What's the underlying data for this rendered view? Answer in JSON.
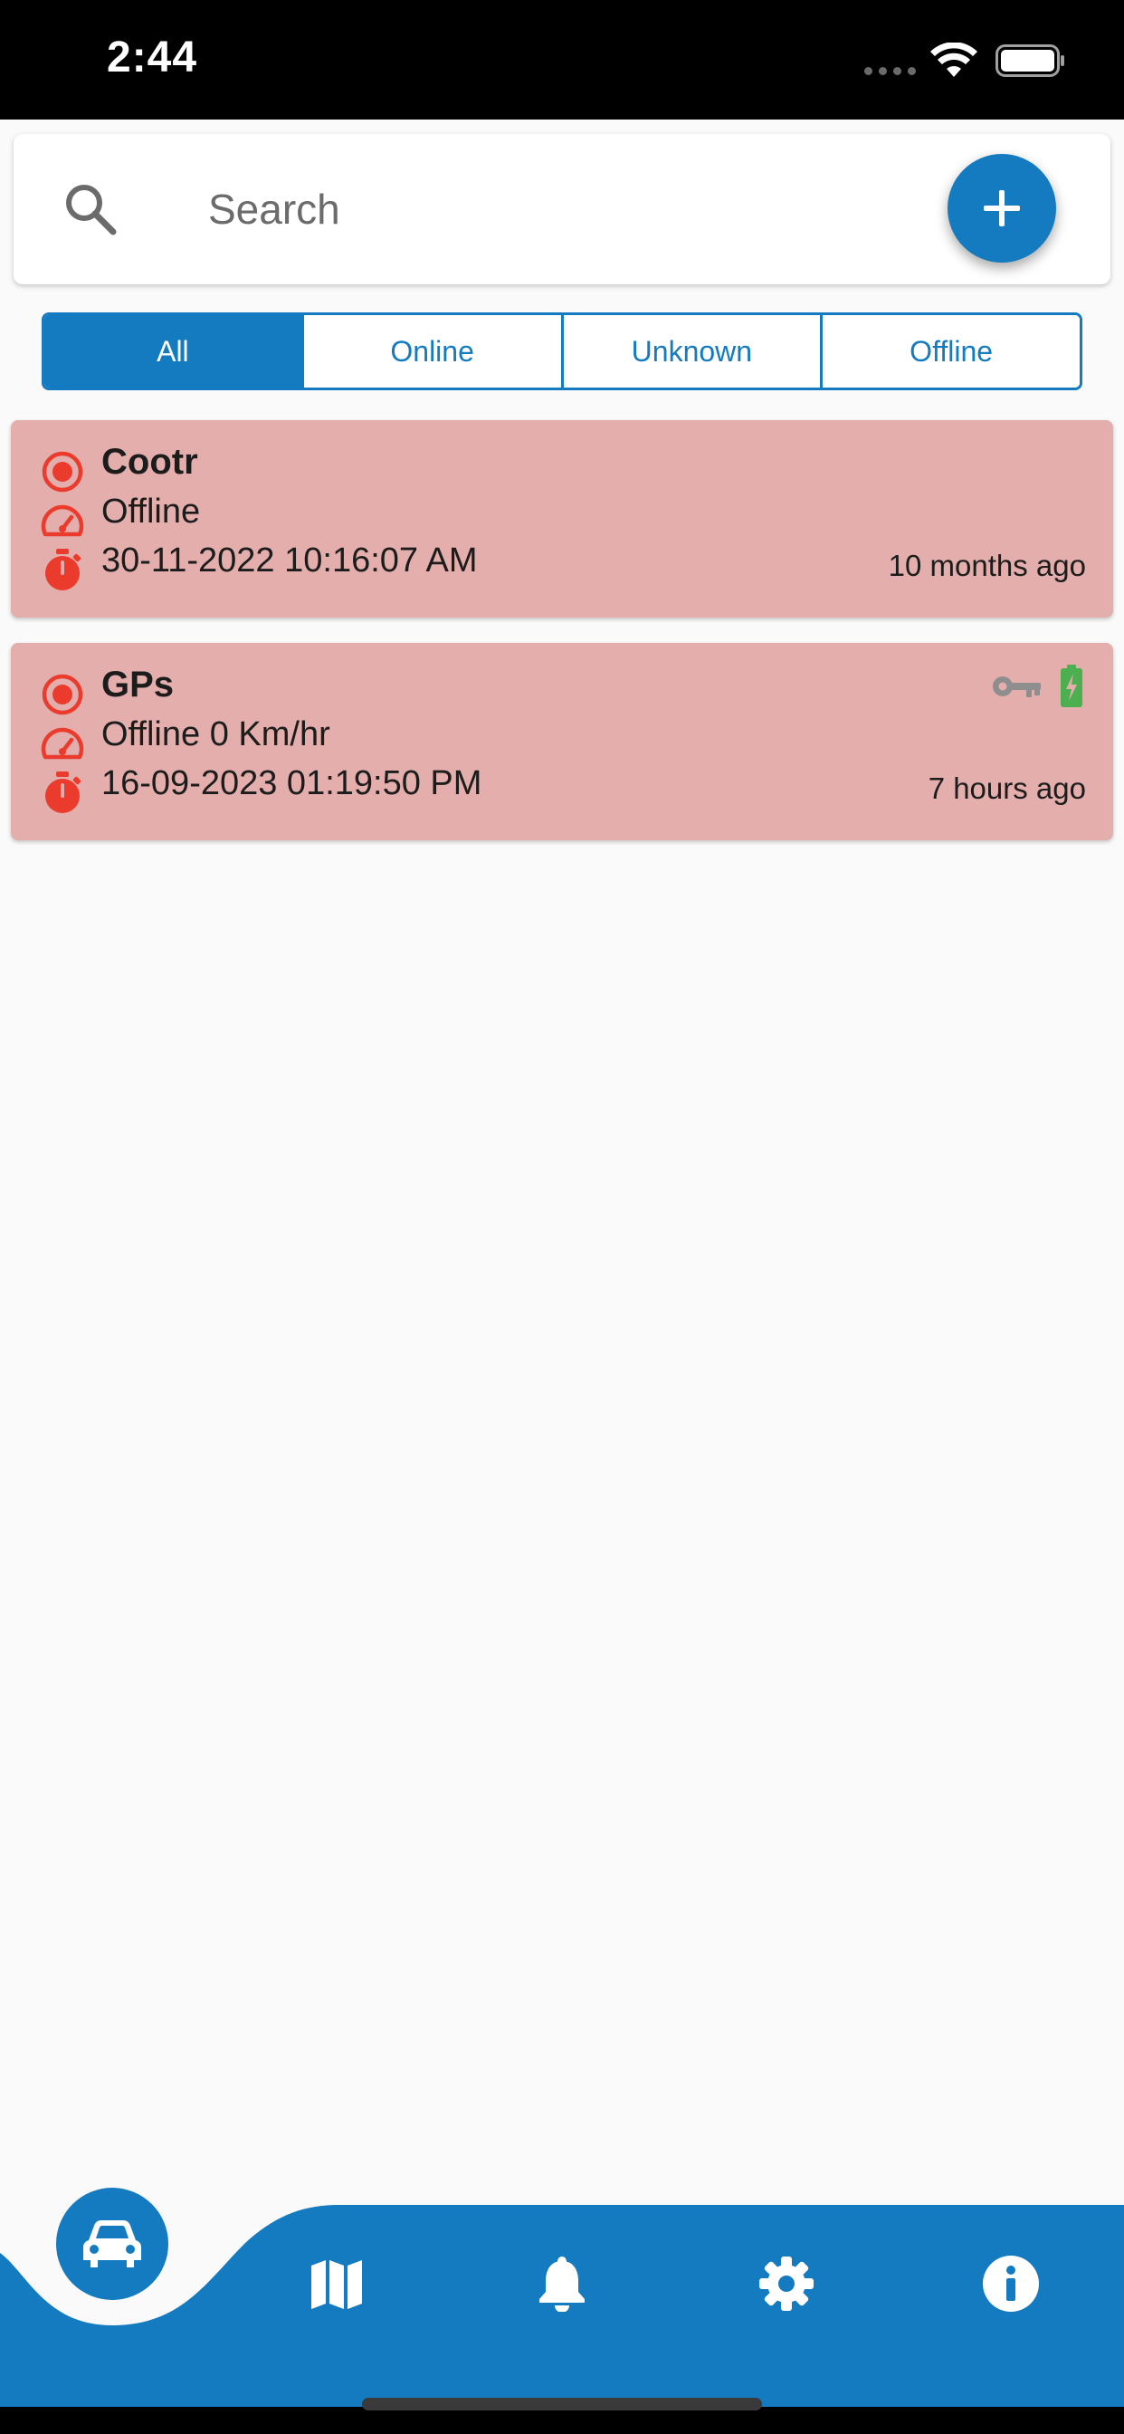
{
  "status_bar": {
    "time": "2:44"
  },
  "search": {
    "placeholder": "Search",
    "value": ""
  },
  "filters": [
    {
      "label": "All",
      "active": true
    },
    {
      "label": "Online",
      "active": false
    },
    {
      "label": "Unknown",
      "active": false
    },
    {
      "label": "Offline",
      "active": false
    }
  ],
  "devices": [
    {
      "name": "Cootr",
      "status": "Offline",
      "timestamp": "30-11-2022 10:16:07 AM",
      "ago": "10 months ago"
    },
    {
      "name": "GPs",
      "status": "Offline 0 Km/hr",
      "timestamp": "16-09-2023 01:19:50 PM",
      "ago": "7 hours ago"
    }
  ],
  "bottom_nav": {
    "items": [
      "car-icon",
      "map-icon",
      "bell-icon",
      "gear-icon",
      "info-icon"
    ],
    "active": "car-icon"
  },
  "colors": {
    "primary": "#147bc1",
    "offline_card": "#e3aeab",
    "offline_icon": "#ea3b2c",
    "battery_green": "#4caf50",
    "key_grey": "#8e8e8e"
  }
}
